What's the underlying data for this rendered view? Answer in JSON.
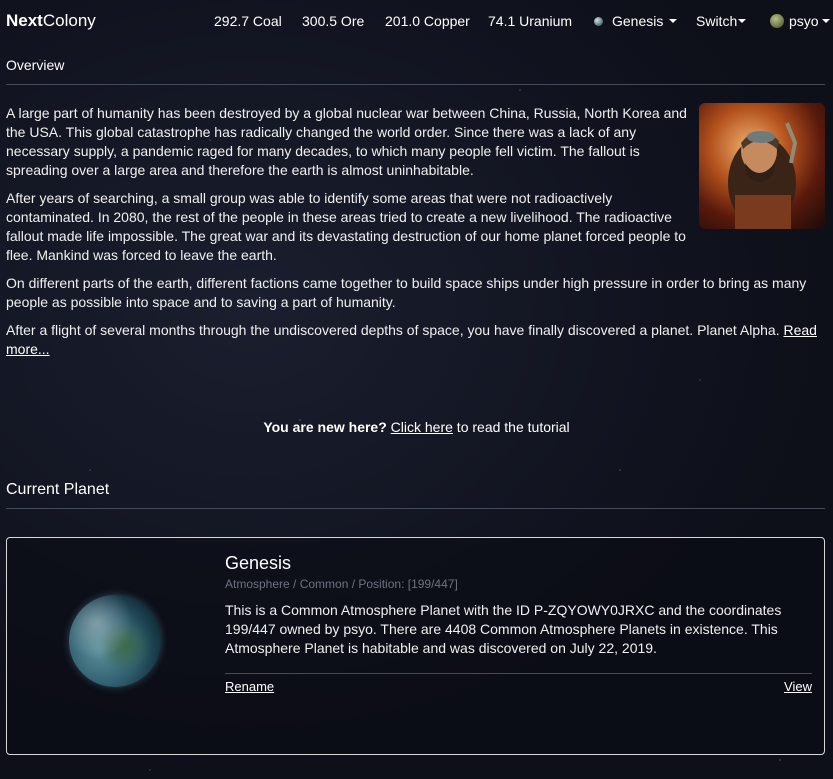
{
  "navbar": {
    "brand_bold": "Next",
    "brand_rest": "Colony",
    "resources": [
      "292.7 Coal",
      "300.5 Ore",
      "201.0 Copper",
      "74.1 Uranium"
    ],
    "planet_selector": "Genesis",
    "switch_label": "Switch",
    "user_label": "psyo"
  },
  "overview": {
    "title": "Overview",
    "paragraphs": [
      "A large part of humanity has been destroyed by a global nuclear war between China, Russia, North Korea and the USA. This global catastrophe has radically changed the world order. Since there was a lack of any necessary supply, a pandemic raged for many decades, to which many people fell victim. The fallout is spreading over a large area and therefore the earth is almost uninhabitable.",
      "After years of searching, a small group was able to identify some areas that were not radioactively contaminated. In 2080, the rest of the people in these areas tried to create a new livelihood. The radioactive fallout made life impossible. The great war and its devastating destruction of our home planet forced people to flee. Mankind was forced to leave the earth.",
      "On different parts of the earth, different factions came together to build space ships under high pressure in order to bring as many people as possible into space and to saving a part of humanity.",
      "After a flight of several months through the undiscovered depths of space, you have finally discovered a planet. Planet Alpha."
    ],
    "read_more": "Read more..."
  },
  "tutorial": {
    "lead": "You are new here?",
    "link": "Click here",
    "rest": " to read the tutorial"
  },
  "current_planet": {
    "section_title": "Current Planet",
    "name": "Genesis",
    "meta": "Atmosphere / Common / Position: [199/447]",
    "description": "This is a Common Atmosphere Planet with the ID P-ZQYOWY0JRXC and the coordinates 199/447 owned by psyo. There are 4408 Common Atmosphere Planets in existence. This Atmosphere Planet is habitable and was discovered on July 22, 2019.",
    "rename_label": "Rename",
    "view_label": "View"
  }
}
